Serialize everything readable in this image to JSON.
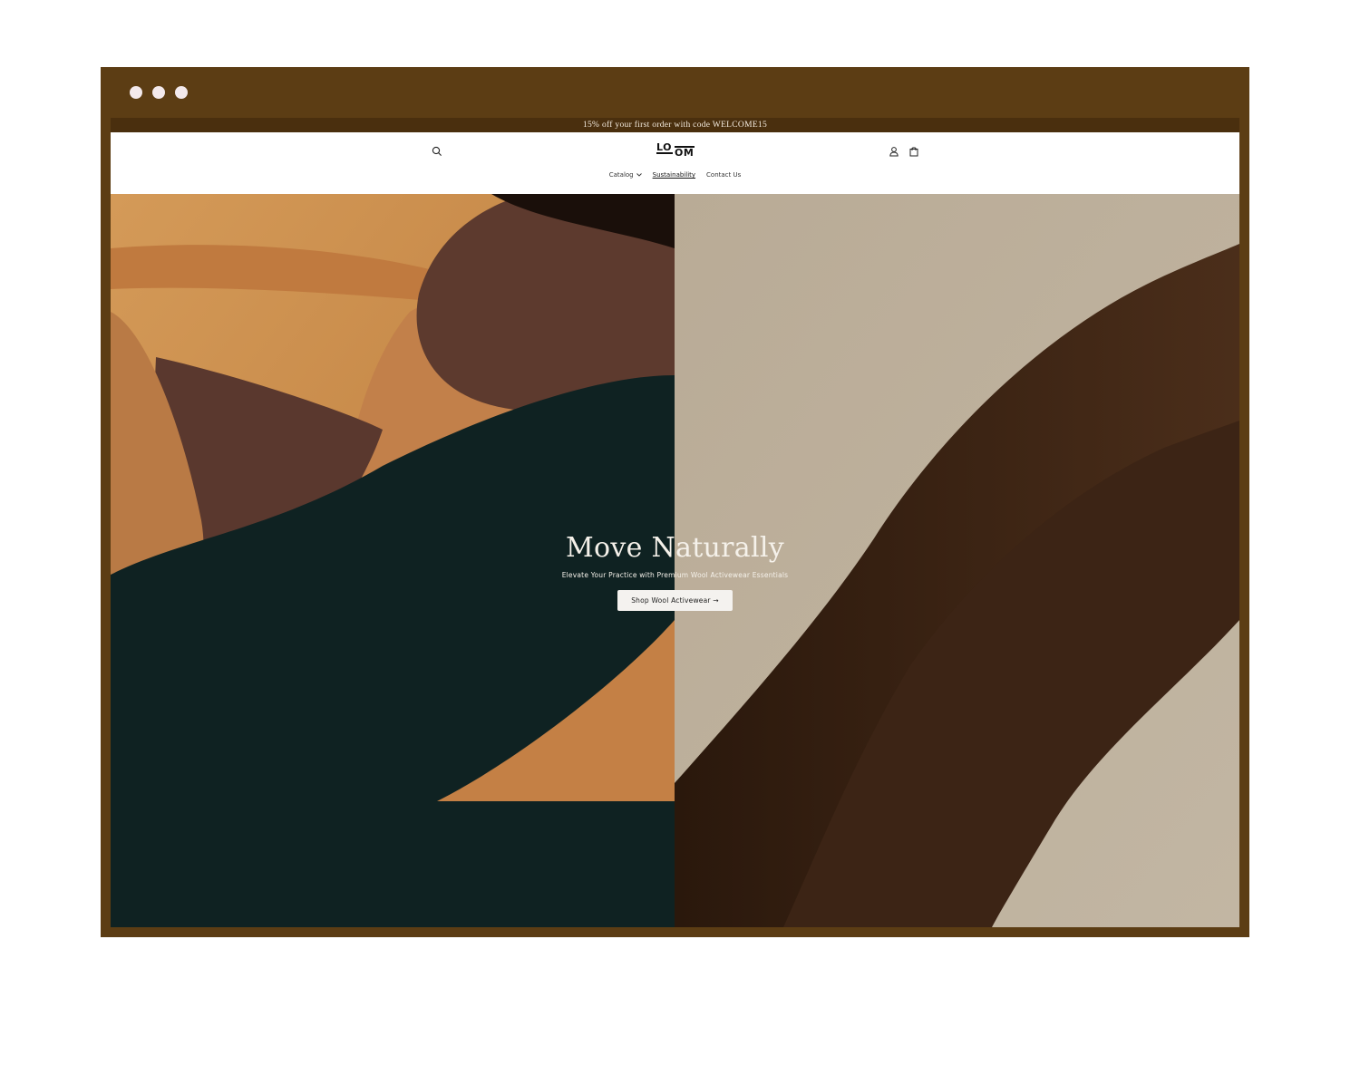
{
  "announcement": {
    "text": "15% off your first order with code WELCOME15"
  },
  "header": {
    "icons": {
      "search": "search-icon",
      "account": "user-icon",
      "cart": "bag-icon"
    },
    "logo": {
      "top": "LO",
      "bottom": "OM"
    },
    "nav": [
      {
        "label": "Catalog",
        "has_dropdown": true
      },
      {
        "label": "Sustainability",
        "active": true
      },
      {
        "label": "Contact Us"
      }
    ]
  },
  "hero": {
    "title": "Move Naturally",
    "subtitle": "Elevate Your Practice with Premium Wool Activewear Essentials",
    "cta_label": "Shop Wool Activewear →"
  },
  "colors": {
    "frame": "#5c3d14",
    "announcement_bg": "#4a2f0e",
    "hero_left_bg": "#c98c4c",
    "hero_right_bg": "#b5a895",
    "garment_dark": "#0e1f1f",
    "garment_brown": "#3a2415"
  }
}
